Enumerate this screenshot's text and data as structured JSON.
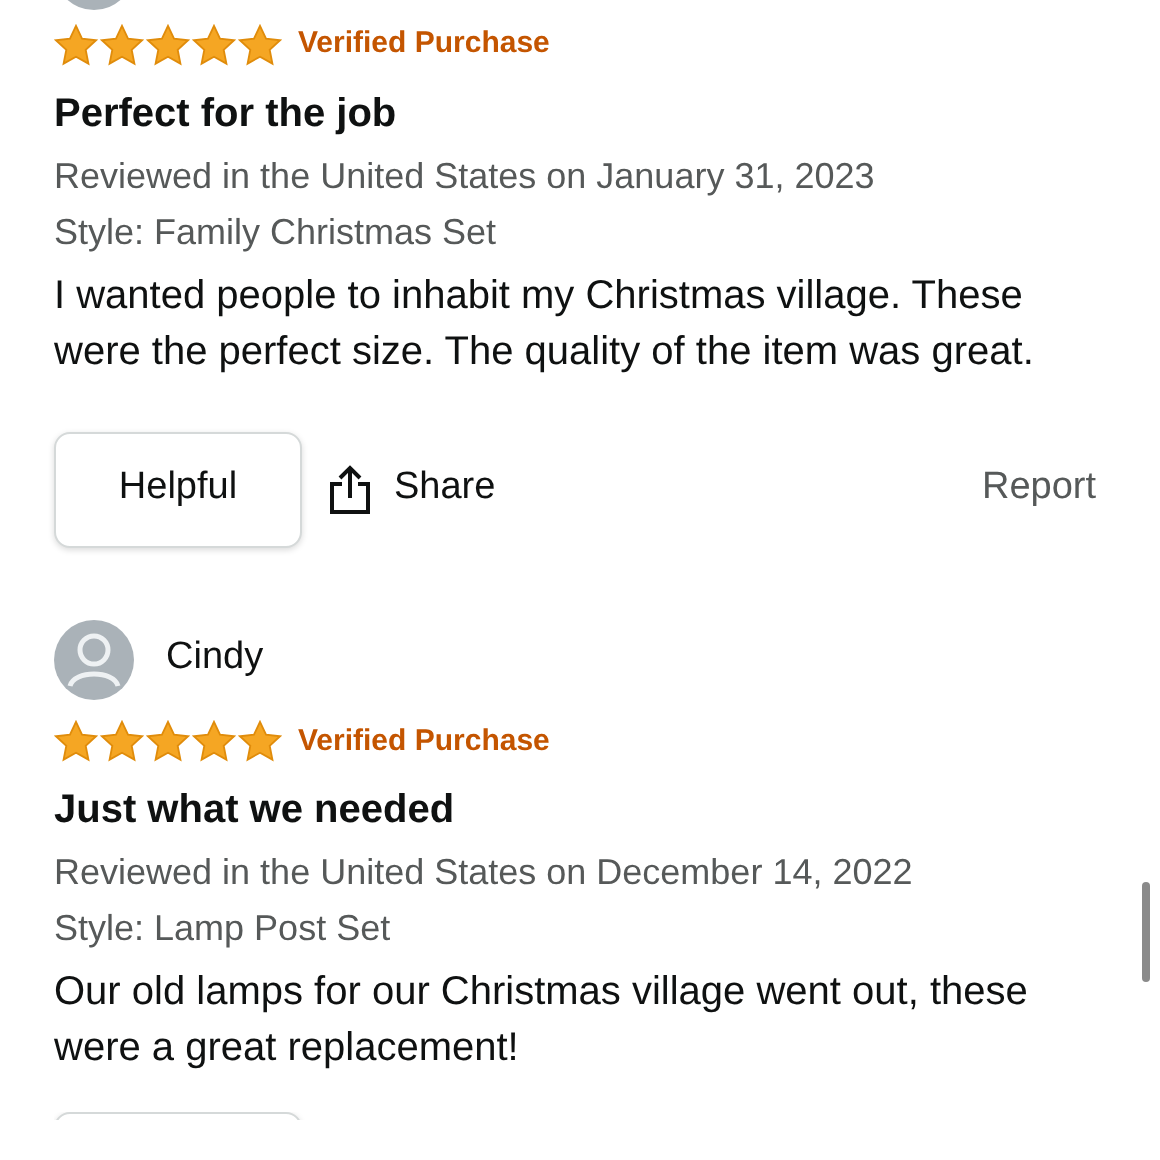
{
  "reviews": [
    {
      "stars": 5,
      "badge": "Verified Purchase",
      "title": "Perfect for the job",
      "meta": "Reviewed in the United States on January 31, 2023",
      "style": "Style: Family Christmas Set",
      "body": "I wanted people to inhabit my Christmas village. These were the perfect size. The quality of the item was great.",
      "actions": {
        "helpful": "Helpful",
        "share": "Share",
        "report": "Report"
      }
    },
    {
      "author": "Cindy",
      "stars": 5,
      "badge": "Verified Purchase",
      "title": "Just what we needed",
      "meta": "Reviewed in the United States on December 14, 2022",
      "style": "Style: Lamp Post Set",
      "body": "Our old lamps for our Christmas village went out, these were a great replacement!",
      "actions_cut": true
    }
  ]
}
